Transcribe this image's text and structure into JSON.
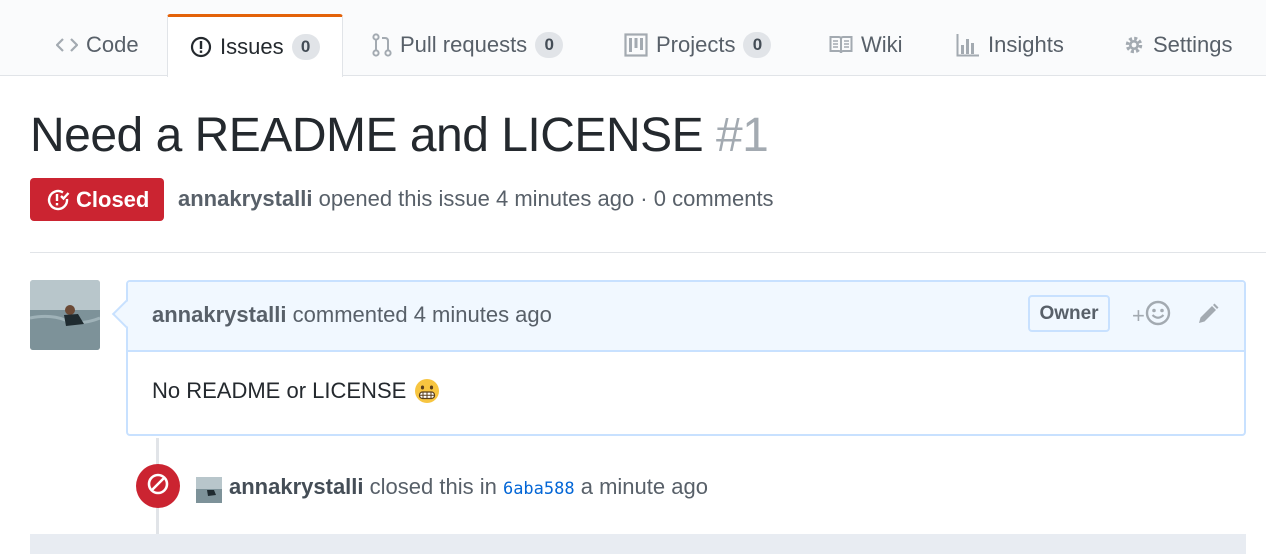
{
  "tabs": [
    {
      "label": "Code",
      "icon": "code-icon",
      "counter": null
    },
    {
      "label": "Issues",
      "icon": "issue-opened-icon",
      "counter": "0"
    },
    {
      "label": "Pull requests",
      "icon": "git-pull-request-icon",
      "counter": "0"
    },
    {
      "label": "Projects",
      "icon": "project-icon",
      "counter": "0"
    },
    {
      "label": "Wiki",
      "icon": "book-icon",
      "counter": null
    },
    {
      "label": "Insights",
      "icon": "graph-icon",
      "counter": null
    },
    {
      "label": "Settings",
      "icon": "gear-icon",
      "counter": null
    }
  ],
  "selected_tab": "Issues",
  "issue": {
    "title": "Need a README and LICENSE",
    "number": "#1",
    "state": "Closed",
    "author": "annakrystalli",
    "meta_rest": "opened this issue 4 minutes ago · 0 comments"
  },
  "comment": {
    "author": "annakrystalli",
    "action": "commented 4 minutes ago",
    "role": "Owner",
    "body": "No README or LICENSE",
    "emoji": "grimacing-face-emoji",
    "reaction_plus": "+"
  },
  "event": {
    "actor": "annakrystalli",
    "action": "closed this in",
    "commit": "6aba588",
    "time": "a minute ago"
  },
  "colors": {
    "closed_red": "#cb2431",
    "accent_orange": "#e36209",
    "header_blue": "#f1f8ff",
    "border_blue": "#c8e1ff",
    "link_blue": "#0366d6"
  }
}
